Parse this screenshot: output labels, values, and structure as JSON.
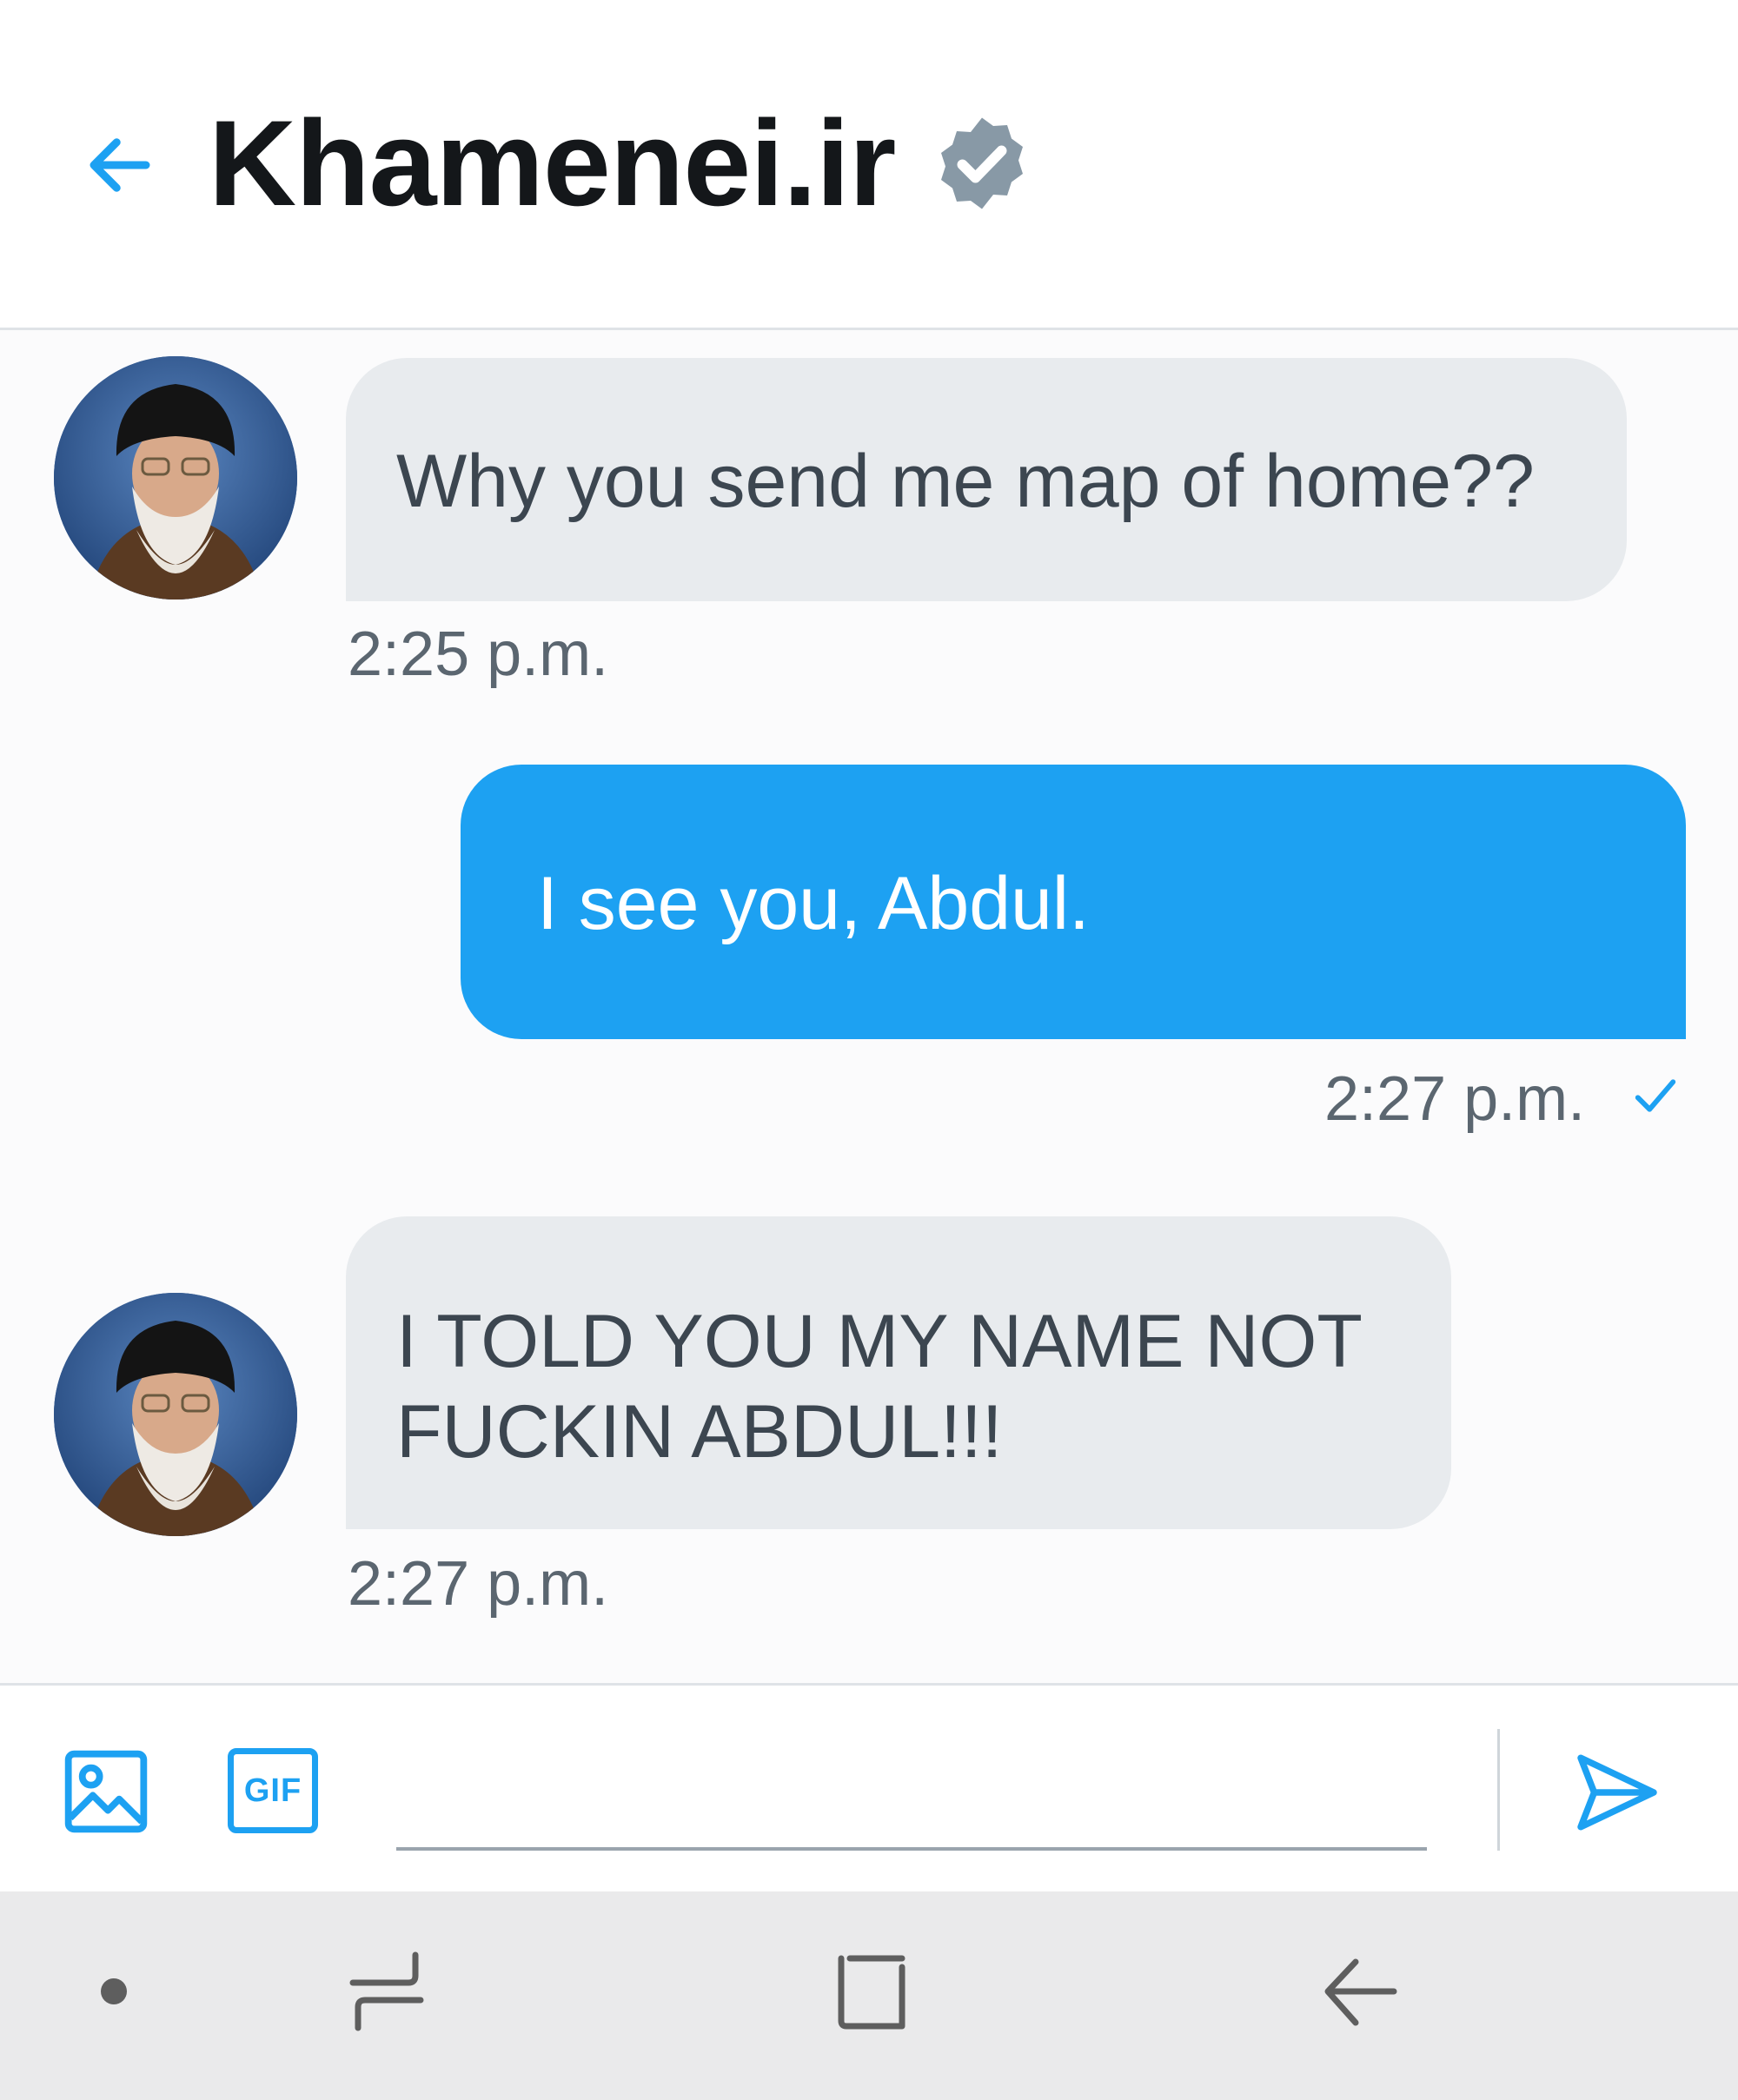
{
  "header": {
    "title": "Khamenei.ir",
    "verified": true,
    "back_icon": "arrow-left-icon",
    "verified_icon": "verified-badge-icon"
  },
  "messages": [
    {
      "direction": "incoming",
      "text": "Why you send me map of home??",
      "time": "2:25 p.m."
    },
    {
      "direction": "outgoing",
      "text": "I see you, Abdul.",
      "time": "2:27 p.m.",
      "status_icon": "check-icon"
    },
    {
      "direction": "incoming",
      "text": "I TOLD YOU MY NAME NOT FUCKIN ABDUL!!!",
      "time": "2:27 p.m."
    }
  ],
  "composer": {
    "image_icon": "image-icon",
    "gif_label": "GIF",
    "input_placeholder": "",
    "send_icon": "send-icon"
  },
  "navbar": {
    "items": [
      "dot-icon",
      "recent-apps-icon",
      "home-icon",
      "back-icon"
    ]
  },
  "colors": {
    "accent": "#1da1f2",
    "incoming_bubble": "#e8ebee",
    "incoming_text": "#3c4650",
    "verified_badge": "#8899a6",
    "navbar_bg": "#eaeaeb"
  }
}
